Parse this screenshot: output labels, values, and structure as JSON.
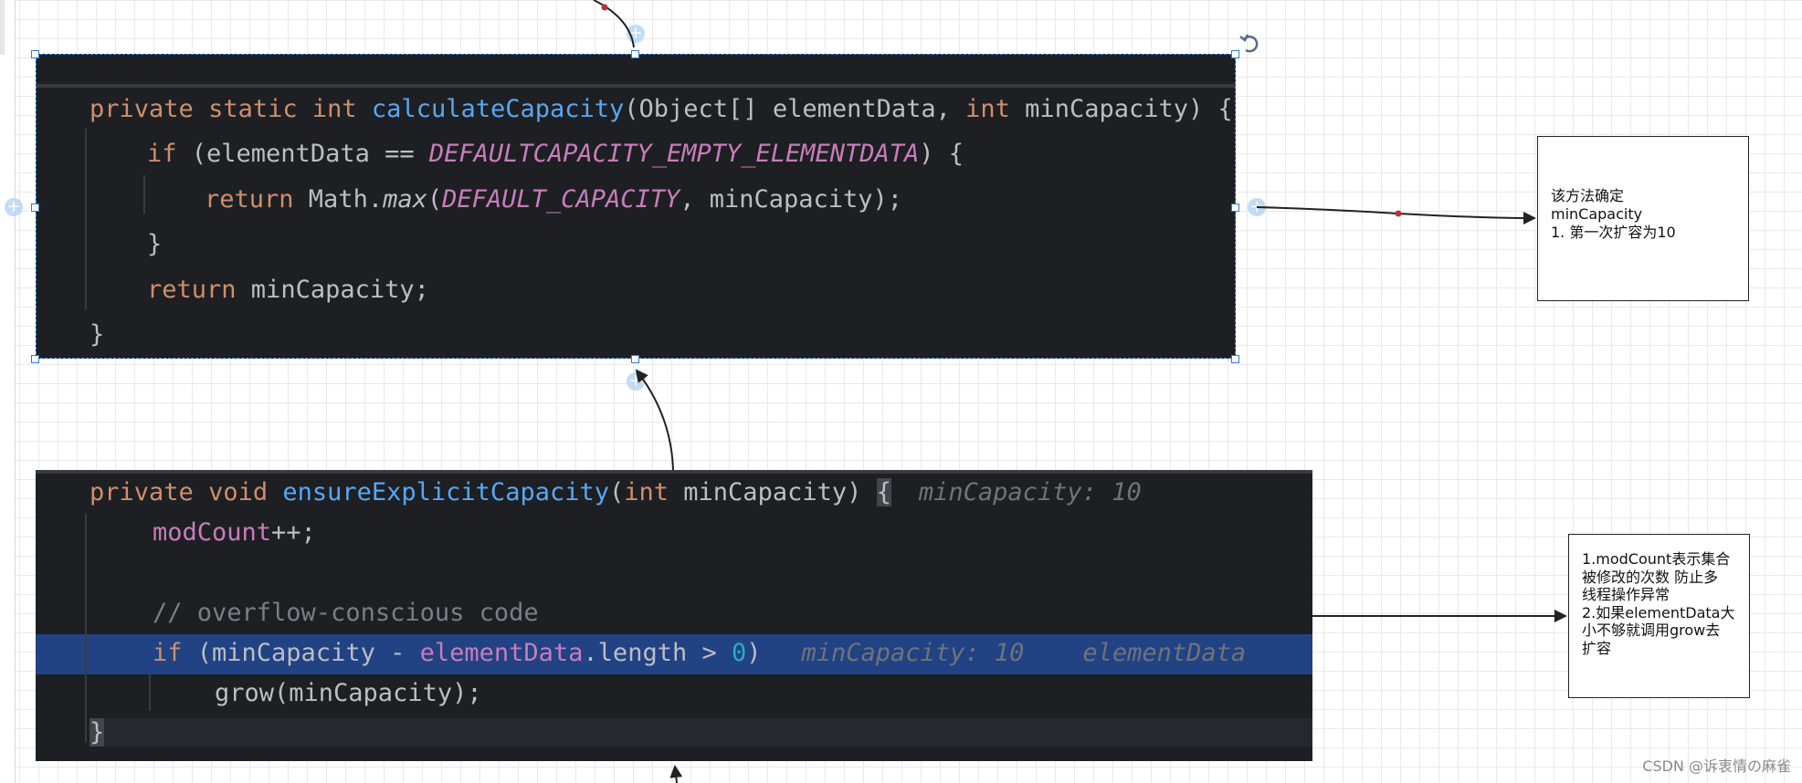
{
  "upper_code": {
    "lines": {
      "l1": {
        "kw1": "private",
        "kw2": "static",
        "kw3": "int",
        "fn": "calculateCapacity",
        "p1": "(Object[] elementData, ",
        "kw4": "int",
        "p2": " minCapacity) {"
      },
      "l2": {
        "kw": "if",
        "p1": " (elementData == ",
        "const": "DEFAULTCAPACITY_EMPTY_ELEMENTDATA",
        "p2": ") {"
      },
      "l3": {
        "kw": "return",
        "p1": " Math.",
        "sfn": "max",
        "p2": "(",
        "const": "DEFAULT_CAPACITY",
        "p3": ", minCapacity);"
      },
      "l4": {
        "text": "}"
      },
      "l5": {
        "kw": "return",
        "p1": " minCapacity;"
      },
      "l6": {
        "text": "}"
      }
    }
  },
  "lower_code": {
    "lines": {
      "l1": {
        "kw1": "private",
        "kw2": "void",
        "fn": "ensureExplicitCapacity",
        "p1": "(",
        "kw3": "int",
        "p2": " minCapacity) ",
        "brace": "{",
        "hint": "minCapacity: 10"
      },
      "l2": {
        "field": "modCount",
        "p1": "++;"
      },
      "l3": {
        "comment": "// overflow-conscious code"
      },
      "l4": {
        "kw": "if",
        "p1": " (minCapacity - ",
        "field": "elementData",
        "p2": ".length > ",
        "num": "0",
        "p3": ")",
        "hint1": "minCapacity: 10",
        "hint2": "elementData"
      },
      "l5": {
        "p1": "grow(minCapacity);"
      },
      "l6": {
        "text": "}"
      }
    }
  },
  "note_upper": {
    "lines": [
      "该方法确定",
      "minCapacity",
      "1. 第一次扩容为10"
    ]
  },
  "note_lower": {
    "lines": [
      "1.modCount表示集合",
      "被修改的次数 防止多",
      "线程操作异常",
      "2.如果elementData大",
      "小不够就调用grow去",
      "扩容"
    ]
  },
  "watermark": "CSDN @诉衷情の麻雀",
  "icons": {
    "rotate": "rotate-icon",
    "plus": "plus-icon"
  }
}
